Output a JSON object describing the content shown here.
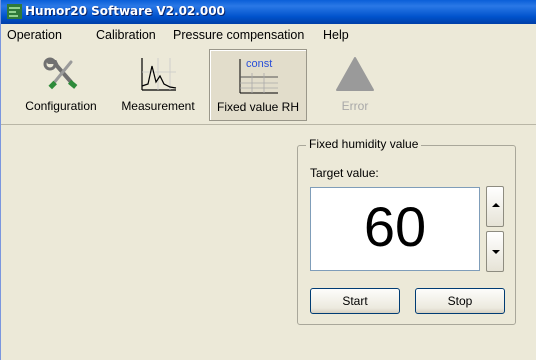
{
  "window": {
    "title": "Humor20 Software V2.02.000"
  },
  "menu": [
    "Operation",
    "Calibration",
    "Pressure compensation",
    "Help"
  ],
  "toolbar": {
    "configuration": "Configuration",
    "measurement": "Measurement",
    "fixed_value_rh": "Fixed value RH",
    "fixed_value_icon_text": "const",
    "error": "Error"
  },
  "fixed_humidity": {
    "group_title": "Fixed humidity value",
    "target_label": "Target value:",
    "target_value": "60",
    "start_label": "Start",
    "stop_label": "Stop"
  },
  "colors": {
    "titlebar": "#0a5fd8",
    "window_bg": "#ece9d8",
    "error_icon": "#9a9a9a",
    "const_text": "#2a4fd8"
  },
  "icons": [
    "app-icon",
    "wrench-screwdriver-icon",
    "measurement-graph-icon",
    "fixed-value-grid-icon",
    "error-warning-icon"
  ]
}
